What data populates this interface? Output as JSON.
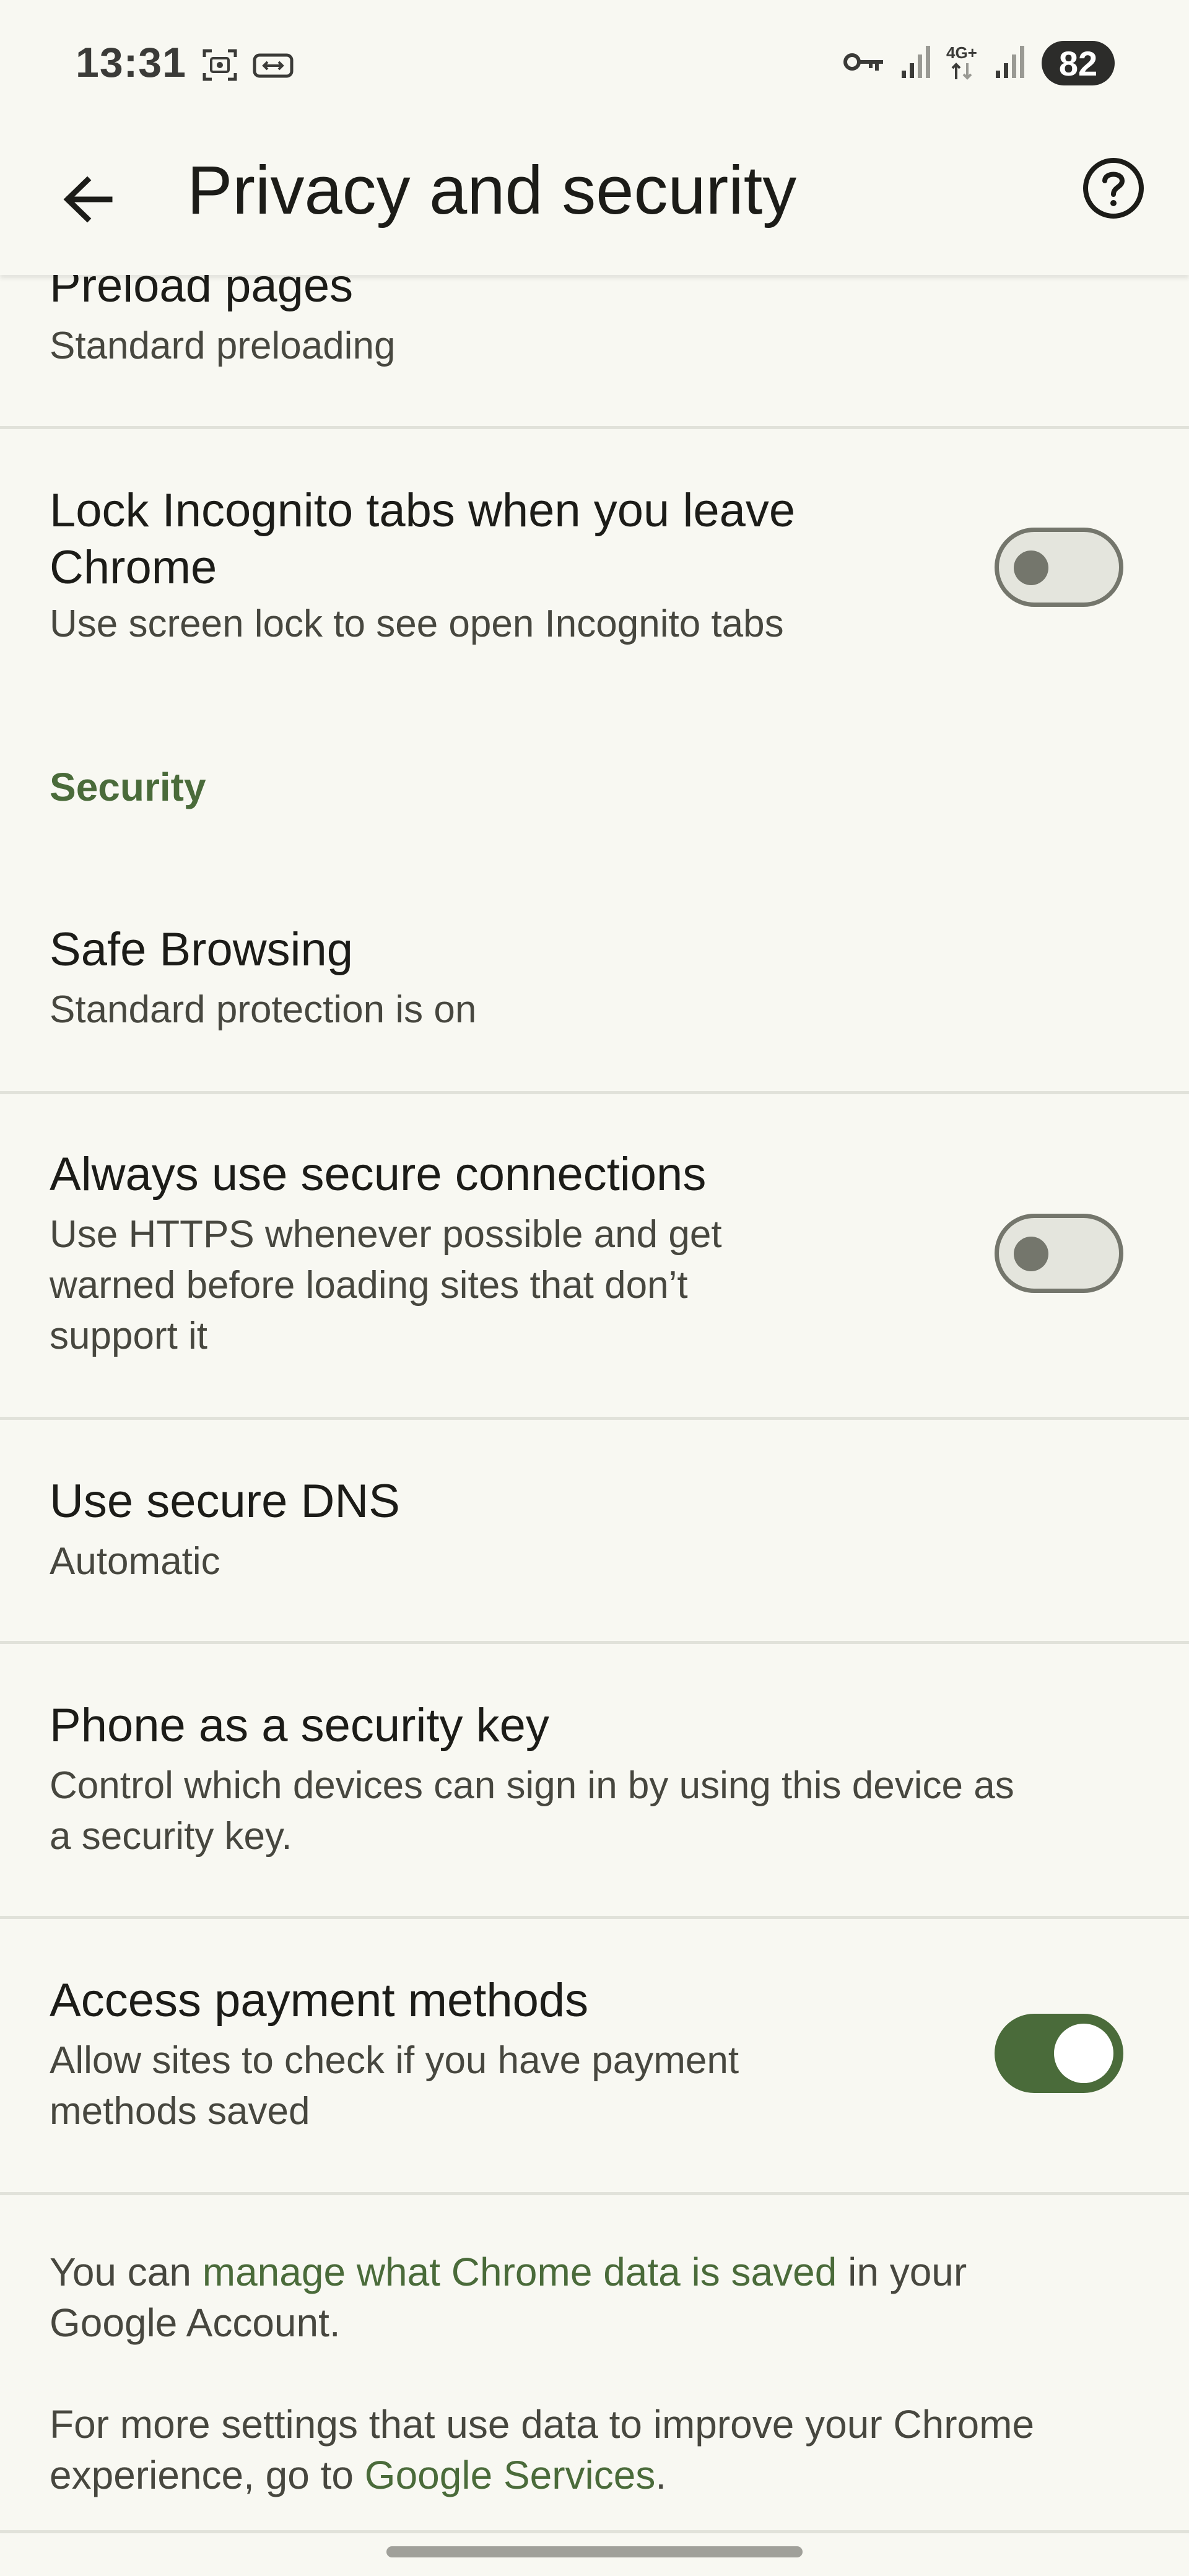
{
  "status_bar": {
    "time": "13:31",
    "network": "4G+",
    "battery": "82"
  },
  "app_bar": {
    "title": "Privacy and security"
  },
  "settings": {
    "preload": {
      "title": "Preload pages",
      "subtitle": "Standard preloading"
    },
    "lock_incognito": {
      "title_line1": "Lock Incognito tabs when you leave",
      "title_line2": "Chrome",
      "subtitle": "Use screen lock to see open Incognito tabs",
      "enabled": false
    },
    "section_security": "Security",
    "safe_browsing": {
      "title": "Safe Browsing",
      "subtitle": "Standard protection is on"
    },
    "secure_connections": {
      "title": "Always use secure connections",
      "subtitle_line1": "Use HTTPS whenever possible and get",
      "subtitle_line2": "warned before loading sites that don’t",
      "subtitle_line3": "support it",
      "enabled": false
    },
    "secure_dns": {
      "title": "Use secure DNS",
      "subtitle": "Automatic"
    },
    "phone_key": {
      "title": "Phone as a security key",
      "subtitle_line1": "Control which devices can sign in by using this device as",
      "subtitle_line2": "a security key."
    },
    "payment_methods": {
      "title": "Access payment methods",
      "subtitle_line1": "Allow sites to check if you have payment",
      "subtitle_line2": "methods saved",
      "enabled": true
    }
  },
  "footer": {
    "p1_prefix": "You can ",
    "p1_link": "manage what Chrome data is saved",
    "p1_suffix": " in your",
    "p1_line2": "Google Account.",
    "p2_line1": "For more settings that use data to improve your Chrome",
    "p2_prefix": "experience, go to ",
    "p2_link": "Google Services",
    "p2_suffix": "."
  },
  "colors": {
    "background": "#f8f8f2",
    "accent": "#4a6b3a",
    "divider": "#e1e2da"
  }
}
